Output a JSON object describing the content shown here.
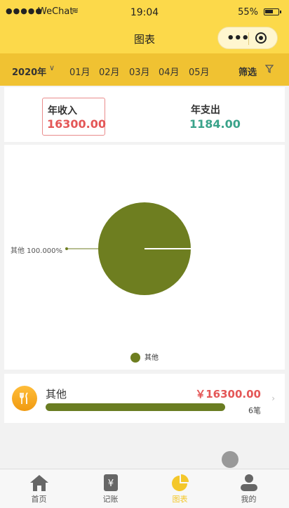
{
  "status": {
    "signal": "●●●●●",
    "carrier": "WeChat",
    "wifi": "≋",
    "time": "19:04",
    "battery": "55%"
  },
  "nav": {
    "title": "图表",
    "capsule_dots": "•••"
  },
  "filter_bar": {
    "year": "2020年",
    "year_arrow": "∨",
    "months": [
      "01月",
      "02月",
      "03月",
      "04月",
      "05月"
    ],
    "filter_label": "筛选",
    "filter_icon": "funnel-icon"
  },
  "summary": {
    "income_label": "年收入",
    "income_value": "16300.00",
    "expense_label": "年支出",
    "expense_value": "1184.00"
  },
  "chart_data": {
    "type": "pie",
    "slices": [
      {
        "label": "其他",
        "value": 100.0,
        "color": "#6e7e20"
      }
    ],
    "slice_label": "其他 100.000%",
    "legend": [
      "其他"
    ],
    "legend_position": "bottom"
  },
  "category": {
    "name": "其他",
    "amount": "￥16300.00",
    "count": "6笔",
    "ratio": 1.0,
    "icon": "fork-knife-icon"
  },
  "tabs": [
    {
      "label": "首页",
      "icon": "home-icon"
    },
    {
      "label": "记账",
      "icon": "ledger-icon"
    },
    {
      "label": "图表",
      "icon": "pie-chart-icon",
      "active": true
    },
    {
      "label": "我的",
      "icon": "user-icon"
    }
  ],
  "colors": {
    "accent": "#fcd94a",
    "filter_bar": "#f0c232",
    "income": "#e45757",
    "expense": "#3aa38a",
    "pie": "#6e7e20"
  }
}
